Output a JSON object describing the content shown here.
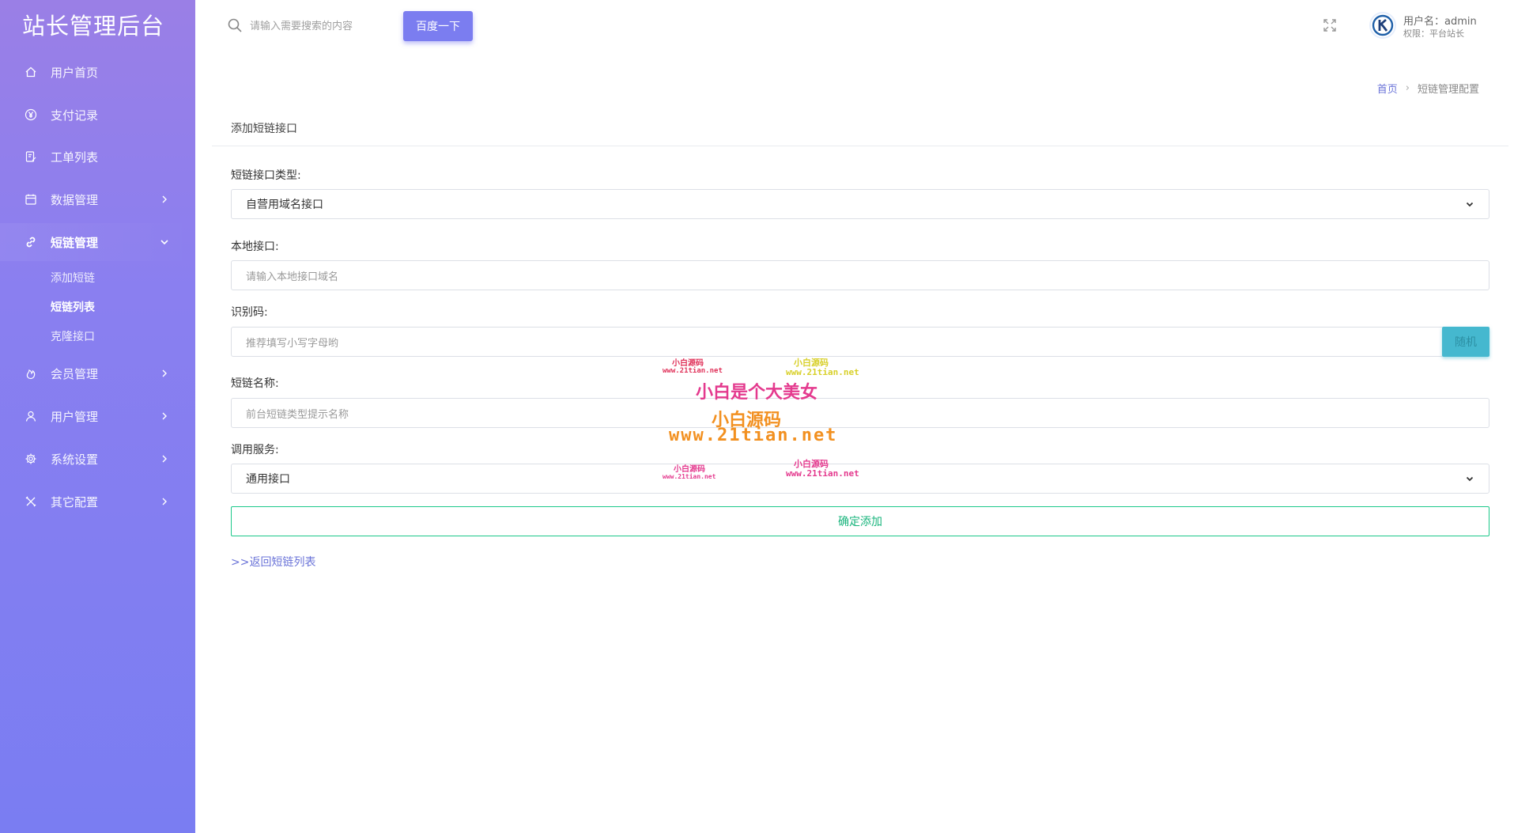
{
  "brand": "站长管理后台",
  "sidebar": {
    "items": [
      {
        "label": "用户首页",
        "icon": "home-icon"
      },
      {
        "label": "支付记录",
        "icon": "yen-icon"
      },
      {
        "label": "工单列表",
        "icon": "ticket-icon"
      },
      {
        "label": "数据管理",
        "icon": "calendar-icon"
      },
      {
        "label": "短链管理",
        "icon": "link-icon"
      },
      {
        "label": "会员管理",
        "icon": "fire-icon"
      },
      {
        "label": "用户管理",
        "icon": "user-icon"
      },
      {
        "label": "系统设置",
        "icon": "gear-icon"
      },
      {
        "label": "其它配置",
        "icon": "tools-icon"
      }
    ],
    "subitems": [
      {
        "label": "添加短链"
      },
      {
        "label": "短链列表"
      },
      {
        "label": "克隆接口"
      }
    ]
  },
  "topbar": {
    "search_placeholder": "请输入需要搜索的内容",
    "search_button": "百度一下",
    "user_name": "用户名：admin",
    "user_role": "权限：平台站长"
  },
  "breadcrumb": {
    "home": "首页",
    "separator": "›",
    "current": "短链管理配置"
  },
  "form": {
    "title": "添加短链接口",
    "type_label": "短链接口类型:",
    "type_value": "自营用域名接口",
    "local_label": "本地接口:",
    "local_placeholder": "请输入本地接口域名",
    "code_label": "识别码:",
    "code_placeholder": "推荐填写小写字母哟",
    "random_button": "随机",
    "name_label": "短链名称:",
    "name_placeholder": "前台短链类型提示名称",
    "service_label": "调用服务:",
    "service_value": "通用接口",
    "submit": "确定添加",
    "back_link": ">>返回短链列表"
  },
  "watermarks": {
    "small_1": "小白源码",
    "small_url_1": "www.21tian.net",
    "small_2": "小白源码",
    "small_url_2": "www.21tian.net",
    "big_text": "小白是个大美女",
    "big_brand": "小白源码",
    "big_url": "www.21tian.net",
    "small_3": "小白源码",
    "small_url_3": "www.21tian.net",
    "small_4": "小白源码",
    "small_url_4": "www.21tian.net"
  },
  "colors": {
    "sidebar_top": "#9a7fe6",
    "sidebar_bottom": "#7a7df2",
    "primary": "#7b7df0",
    "success": "#1cc88a",
    "info": "#45b8cf",
    "link": "#6a73d8"
  }
}
